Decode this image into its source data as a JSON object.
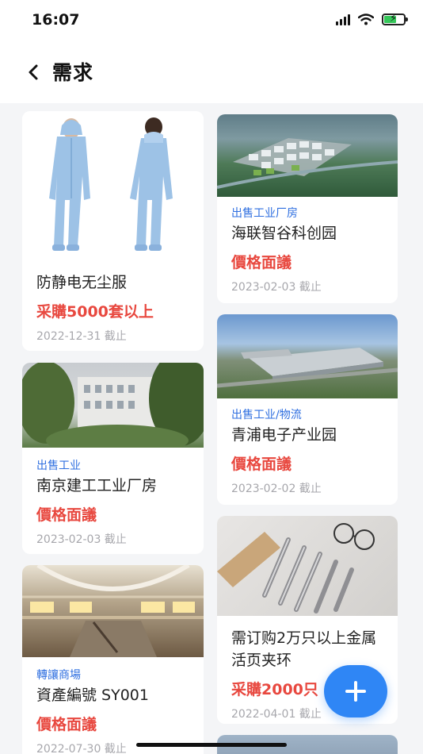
{
  "status_bar": {
    "time": "16:07"
  },
  "nav": {
    "title": "需求"
  },
  "cards": [
    {
      "image": "anti-static-suit-photo",
      "category": "",
      "title": "防静电无尘服",
      "price": "采購5000套以上",
      "deadline": "2022-12-31 截止"
    },
    {
      "image": "industrial-park-aerial-photo",
      "category": "出售工业厂房",
      "title": "海联智谷科创园",
      "price": "價格面議",
      "deadline": "2023-02-03 截止"
    },
    {
      "image": "factory-building-photo",
      "category": "出售工业",
      "title": "南京建工工业厂房",
      "price": "價格面議",
      "deadline": "2023-02-03 截止"
    },
    {
      "image": "logistics-park-aerial-photo",
      "category": "出售工业/物流",
      "title": "青浦电子产业园",
      "price": "價格面議",
      "deadline": "2023-02-02 截止"
    },
    {
      "image": "shopping-mall-interior-photo",
      "category": "轉讓商場",
      "title": "資產編號 SY001",
      "price": "價格面議",
      "deadline": "2022-07-30 截止"
    },
    {
      "image": "binder-rings-photo",
      "category": "",
      "title": "需订购2万只以上金属活页夹环",
      "price": "采購2000只",
      "deadline": "2022-04-01 截止"
    }
  ],
  "fab_icon": "plus-icon",
  "colors": {
    "accent": "#2f86f5",
    "category": "#2f6fe0",
    "price": "#e8483f"
  }
}
